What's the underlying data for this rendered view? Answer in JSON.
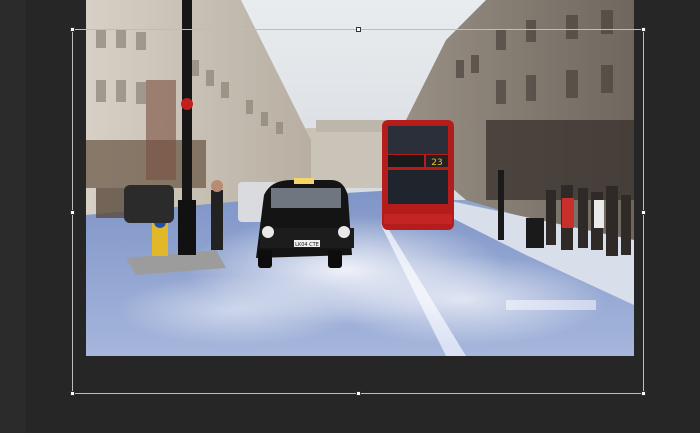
{
  "canvas": {
    "background_color": "#262626",
    "selection_border_color": "#bdbdbd",
    "handle_color": "#ffffff"
  },
  "artboard": {
    "scene": "london-street-photo",
    "bus_route_number": "23",
    "taxi_plate": "LK04 CTE"
  },
  "transform": {
    "handles": [
      "top-left",
      "top-center",
      "top-right",
      "middle-left",
      "middle-right",
      "bottom-left",
      "bottom-center",
      "bottom-right"
    ]
  }
}
